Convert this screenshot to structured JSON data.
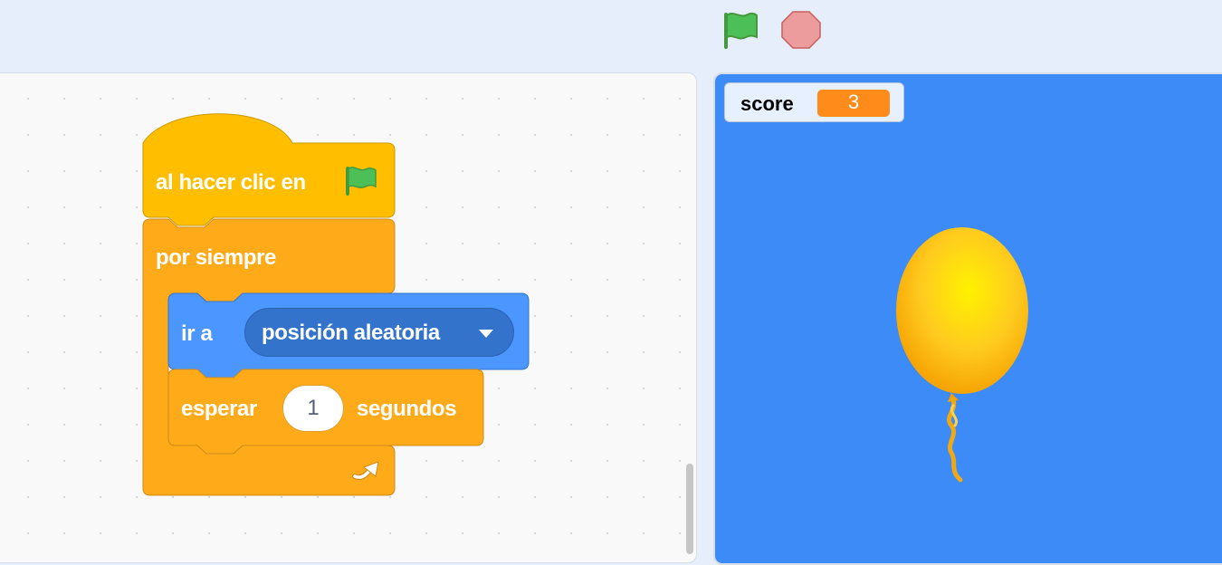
{
  "toolbar": {
    "green_flag_icon": "green-flag-icon",
    "stop_icon": "stop-sign-icon"
  },
  "script": {
    "hat_label": "al hacer clic en",
    "forever_label": "por siempre",
    "goto_label": "ir a",
    "goto_target": "posición aleatoria",
    "wait_label": "esperar",
    "wait_value": "1",
    "wait_unit": "segundos"
  },
  "stage": {
    "monitor_name": "score",
    "monitor_value": "3",
    "sprite": "balloon"
  },
  "colors": {
    "events": "#ffbf00",
    "control": "#ffab19",
    "motion": "#4c97ff",
    "stage_bg": "#3d8bf7",
    "monitor_value": "#ff8c1a"
  }
}
